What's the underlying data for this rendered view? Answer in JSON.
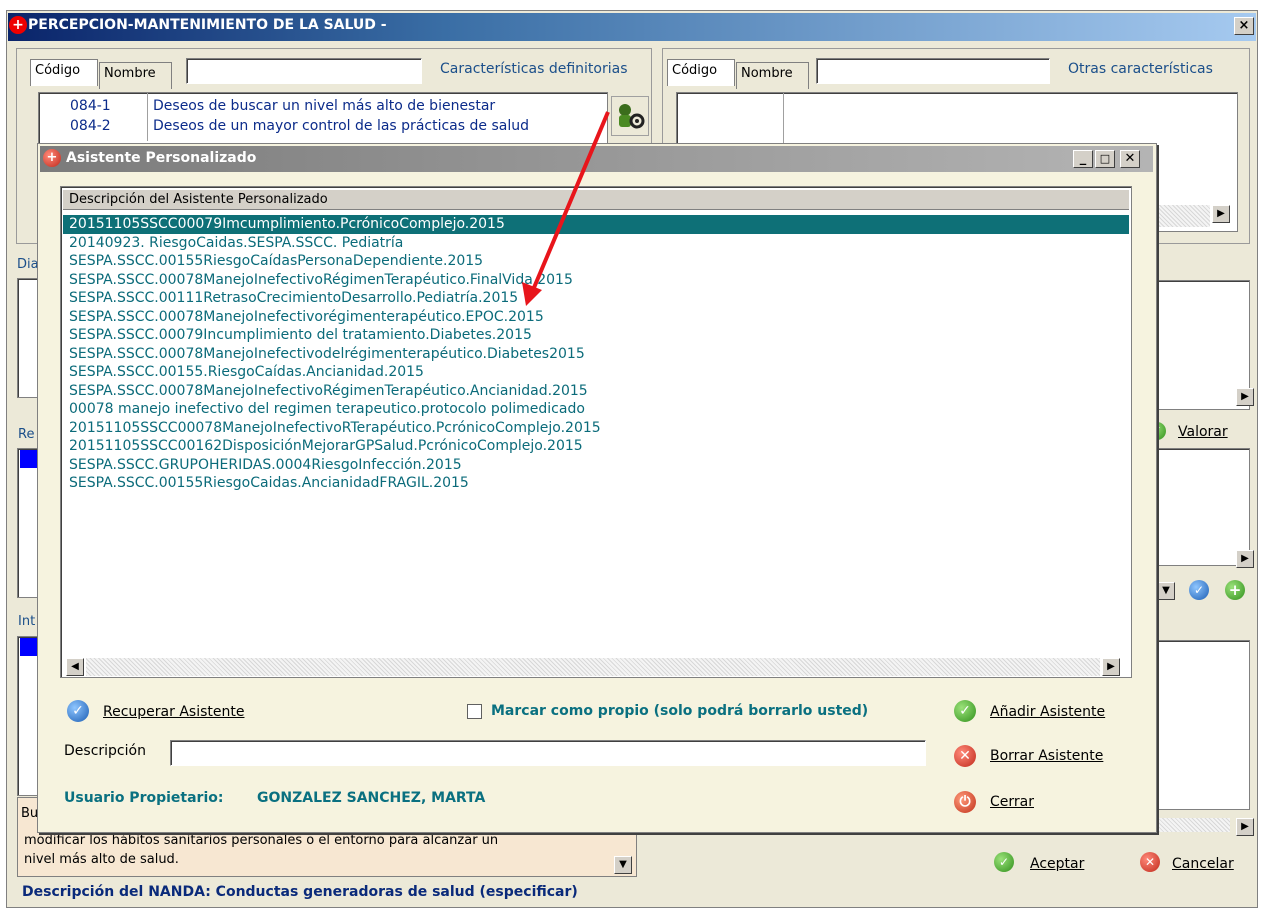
{
  "window": {
    "title": "PERCEPCION-MANTENIMIENTO DE LA SALUD -",
    "close_glyph": "×"
  },
  "left_panel": {
    "tab_code": "Código",
    "tab_name": "Nombre",
    "search_value": "",
    "header": "Características definitorias",
    "items": [
      {
        "code": "084-1",
        "desc": "Deseos de buscar un nivel más alto de bienestar"
      },
      {
        "code": "084-2",
        "desc": "Deseos de un mayor control de las prácticas de salud"
      }
    ]
  },
  "right_panel": {
    "tab_code": "Código",
    "tab_name": "Nombre",
    "search_value": "",
    "header": "Otras características"
  },
  "background_labels": {
    "dia": "Dia",
    "re": "Re",
    "int": "Int",
    "bu": "Bu",
    "valorar": "Valorar",
    "aceptar": "Aceptar",
    "cancelar": "Cancelar"
  },
  "nanda": {
    "text_line1": "modificar los hábitos sanitarios personales o el entorno para alcanzar un",
    "text_line2": "nivel más alto de salud.",
    "description": "Descripción del NANDA: Conductas generadoras de salud (especificar)"
  },
  "dialog": {
    "title": "Asistente Personalizado",
    "list_header": "Descripción del Asistente Personalizado",
    "items": [
      "20151105SSCC00079Imcumplimiento.PcrónicoComplejo.2015",
      "20140923. RiesgoCaidas.SESPA.SSCC. Pediatría",
      "SESPA.SSCC.00155RiesgoCaídasPersonaDependiente.2015",
      "SESPA.SSCC.00078ManejoInefectivoRégimenTerapéutico.FinalVida.2015",
      "SESPA.SSCC.00111RetrasoCrecimientoDesarrollo.Pediatría.2015",
      "SESPA.SSCC.00078ManejoInefectivorégimenterapéutico.EPOC.2015",
      "SESPA.SSCC.00079Incumplimiento del tratamiento.Diabetes.2015",
      "SESPA.SSCC.00078ManejoInefectivodelrégimenterapéutico.Diabetes2015",
      "SESPA.SSCC.00155.RiesgoCaídas.Ancianidad.2015",
      "SESPA.SSCC.00078ManejoInefectivoRégimenTerapéutico.Ancianidad.2015",
      "00078 manejo inefectivo del regimen terapeutico.protocolo polimedicado",
      "20151105SSCC00078ManejoInefectivoRTerapéutico.PcrónicoComplejo.2015",
      "20151105SSCC00162DisposiciónMejorarGPSalud.PcrónicoComplejo.2015",
      "SESPA.SSCC.GRUPOHERIDAS.0004RiesgoInfección.2015",
      "SESPA.SSCC.00155RiesgoCaidas.AncianidadFRAGIL.2015"
    ],
    "recuperar": "Recuperar Asistente",
    "marcar_propio": "Marcar como propio (solo podrá borrarlo usted)",
    "descripcion_label": "Descripción",
    "descripcion_value": "",
    "owner_label": "Usuario Propietario:",
    "owner_name": "GONZALEZ SANCHEZ, MARTA",
    "anadir": "Añadir Asistente",
    "borrar": "Borrar Asistente",
    "cerrar": "Cerrar"
  },
  "colors": {
    "title_blue": "#0a246a",
    "selection_teal": "#0e7077",
    "list_text": "#0b6b7a",
    "arrow_red": "#e8151b"
  }
}
